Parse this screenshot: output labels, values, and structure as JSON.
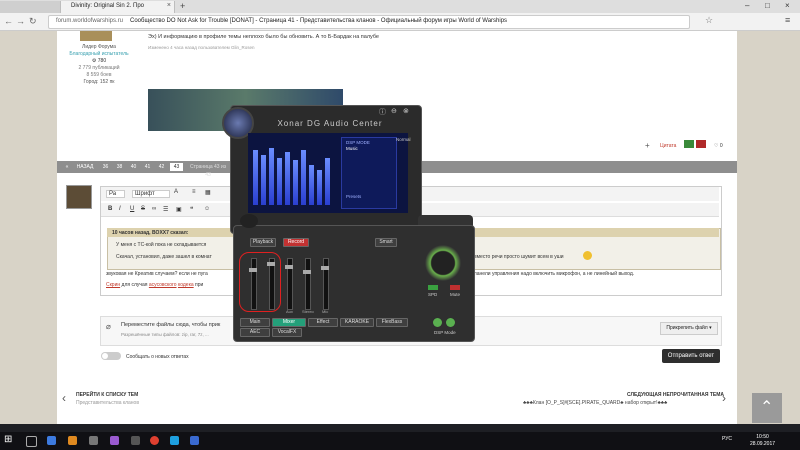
{
  "browser": {
    "tabs": [
      {
        "title": ""
      },
      {
        "title": ""
      },
      {
        "title": "Divinity: Original Sin 2. Про"
      }
    ],
    "url": "forum.worldofwarships.ru",
    "page_title": "Сообщество DO Not Ask for Trouble [DONAT] - Страница 41 - Представительства кланов - Официальный форум игры World of Warships"
  },
  "post": {
    "author_title": "Лидер Форума",
    "author_badge": "Благодарный испытатель",
    "rep": "780",
    "posts": "2 779 публикаций",
    "battles": "8 559 боев",
    "city": "Город: 152 пк",
    "text": "Эх) И информацию в профиле темы неплохо было бы обновить. А то Б-Бардак на палубе",
    "edited": "Изменено 4 часа назад пользователем Glin_Rosen",
    "quote_label": "Цитата",
    "likes": "0"
  },
  "pagination": {
    "prev": "НАЗАД",
    "pages": [
      "36",
      "38",
      "40",
      "41",
      "42",
      "43"
    ],
    "info": "Страница 43 из 43"
  },
  "editor": {
    "font_size": "Ра",
    "font": "Шрифт",
    "quote_header": "10 часов назад, BOXX7 сказал:",
    "quote_line1": "У меня с ТС-кой пока не складывается",
    "quote_line2": "Скачал, установил, даже зашел в комнат",
    "quote_line2_tail": "вместо речи просто шумит всем в уши",
    "body_line1": "звуковая не Креатив случаем? если не пуга",
    "body_line1_tail": "панели управления надо включить микрофон, а не линейный выход.",
    "body_line2_link1": "Скрин",
    "body_line2_mid": " для случая ",
    "body_line2_link2": "асусовского",
    "body_line2_link3": "кодека",
    "body_line2_end": " при"
  },
  "attach": {
    "text": "Переместите файлы сюда, чтобы прик",
    "allowed": "Разрешённые типы файлов: zip, rar, 7z, ...",
    "button": "Прикрепить файл ▾"
  },
  "notify_label": "Сообщать о новых ответах",
  "send_label": "Отправить ответ",
  "bottom_nav": {
    "back_label": "ПЕРЕЙТИ К СПИСКУ ТЕМ",
    "back_sub": "Представительства кланов",
    "next_label": "СЛЕДУЮЩАЯ НЕПРОЧИТАННАЯ ТЕМА",
    "next_sub": "♣♣♣Клан [O_P_S]#[SCE].PIRATE_QUARD♣ набор открыт!♣♣♣"
  },
  "audio_center": {
    "title": "Xonar DG Audio Center",
    "dsp_mode": "DSP MODE",
    "dsp_item": "Music",
    "normal": "Normal",
    "preset": "Presets",
    "playback": "Playback",
    "record": "Record",
    "smart_volume": "Smart",
    "sliders": [
      "",
      "",
      "Aux",
      "Stereo",
      "Mic"
    ],
    "buttons_row1": [
      "Main",
      "Mixer",
      "Effect",
      "KARAOKE",
      "FlexBass"
    ],
    "buttons_row2": [
      "AEC",
      "VocalFX"
    ],
    "spdif": "SPD",
    "mute": "Mute",
    "dsp_mode_label": "DSP Mode"
  },
  "taskbar": {
    "lang": "РУС",
    "time": "10:50",
    "date": "28.09.2017"
  }
}
